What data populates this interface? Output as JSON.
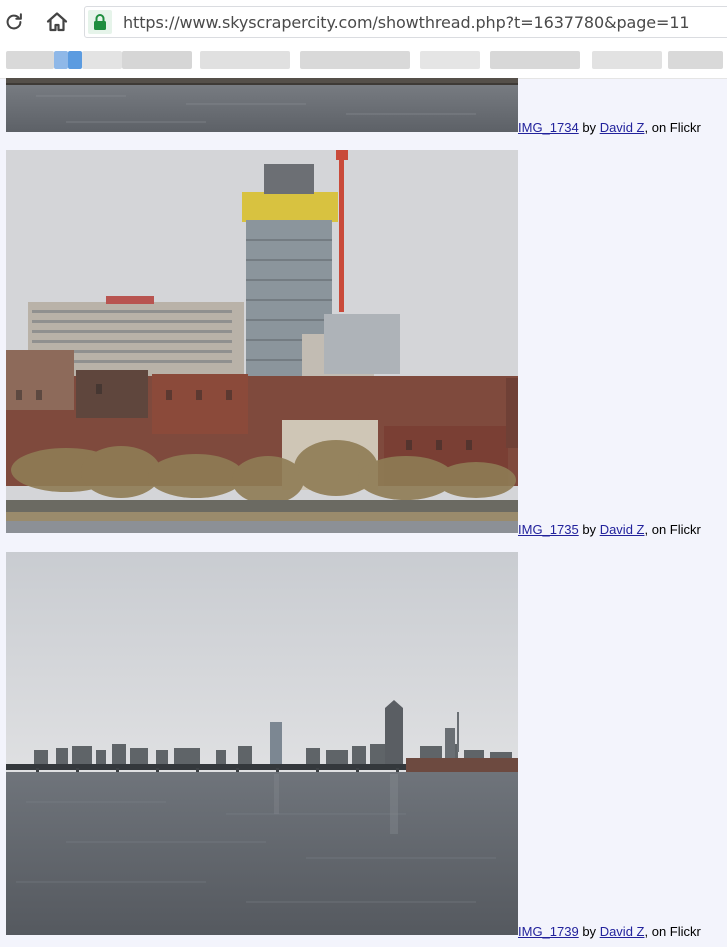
{
  "browser": {
    "url": "https://www.skyscrapercity.com/showthread.php?t=1637780&page=11",
    "icons": {
      "reload": "reload-icon",
      "home": "home-icon",
      "lock": "lock-icon"
    }
  },
  "posts": [
    {
      "title": "IMG_1734",
      "by": "by",
      "author": "David Z",
      "suffix": ", on Flickr"
    },
    {
      "title": "IMG_1735",
      "by": "by",
      "author": "David Z",
      "suffix": ", on Flickr"
    },
    {
      "title": "IMG_1739",
      "by": "by",
      "author": "David Z",
      "suffix": ", on Flickr"
    }
  ],
  "colors": {
    "page_background": "#f3f4fc",
    "link": "#22229c",
    "lock_green": "#1e8e3e"
  }
}
